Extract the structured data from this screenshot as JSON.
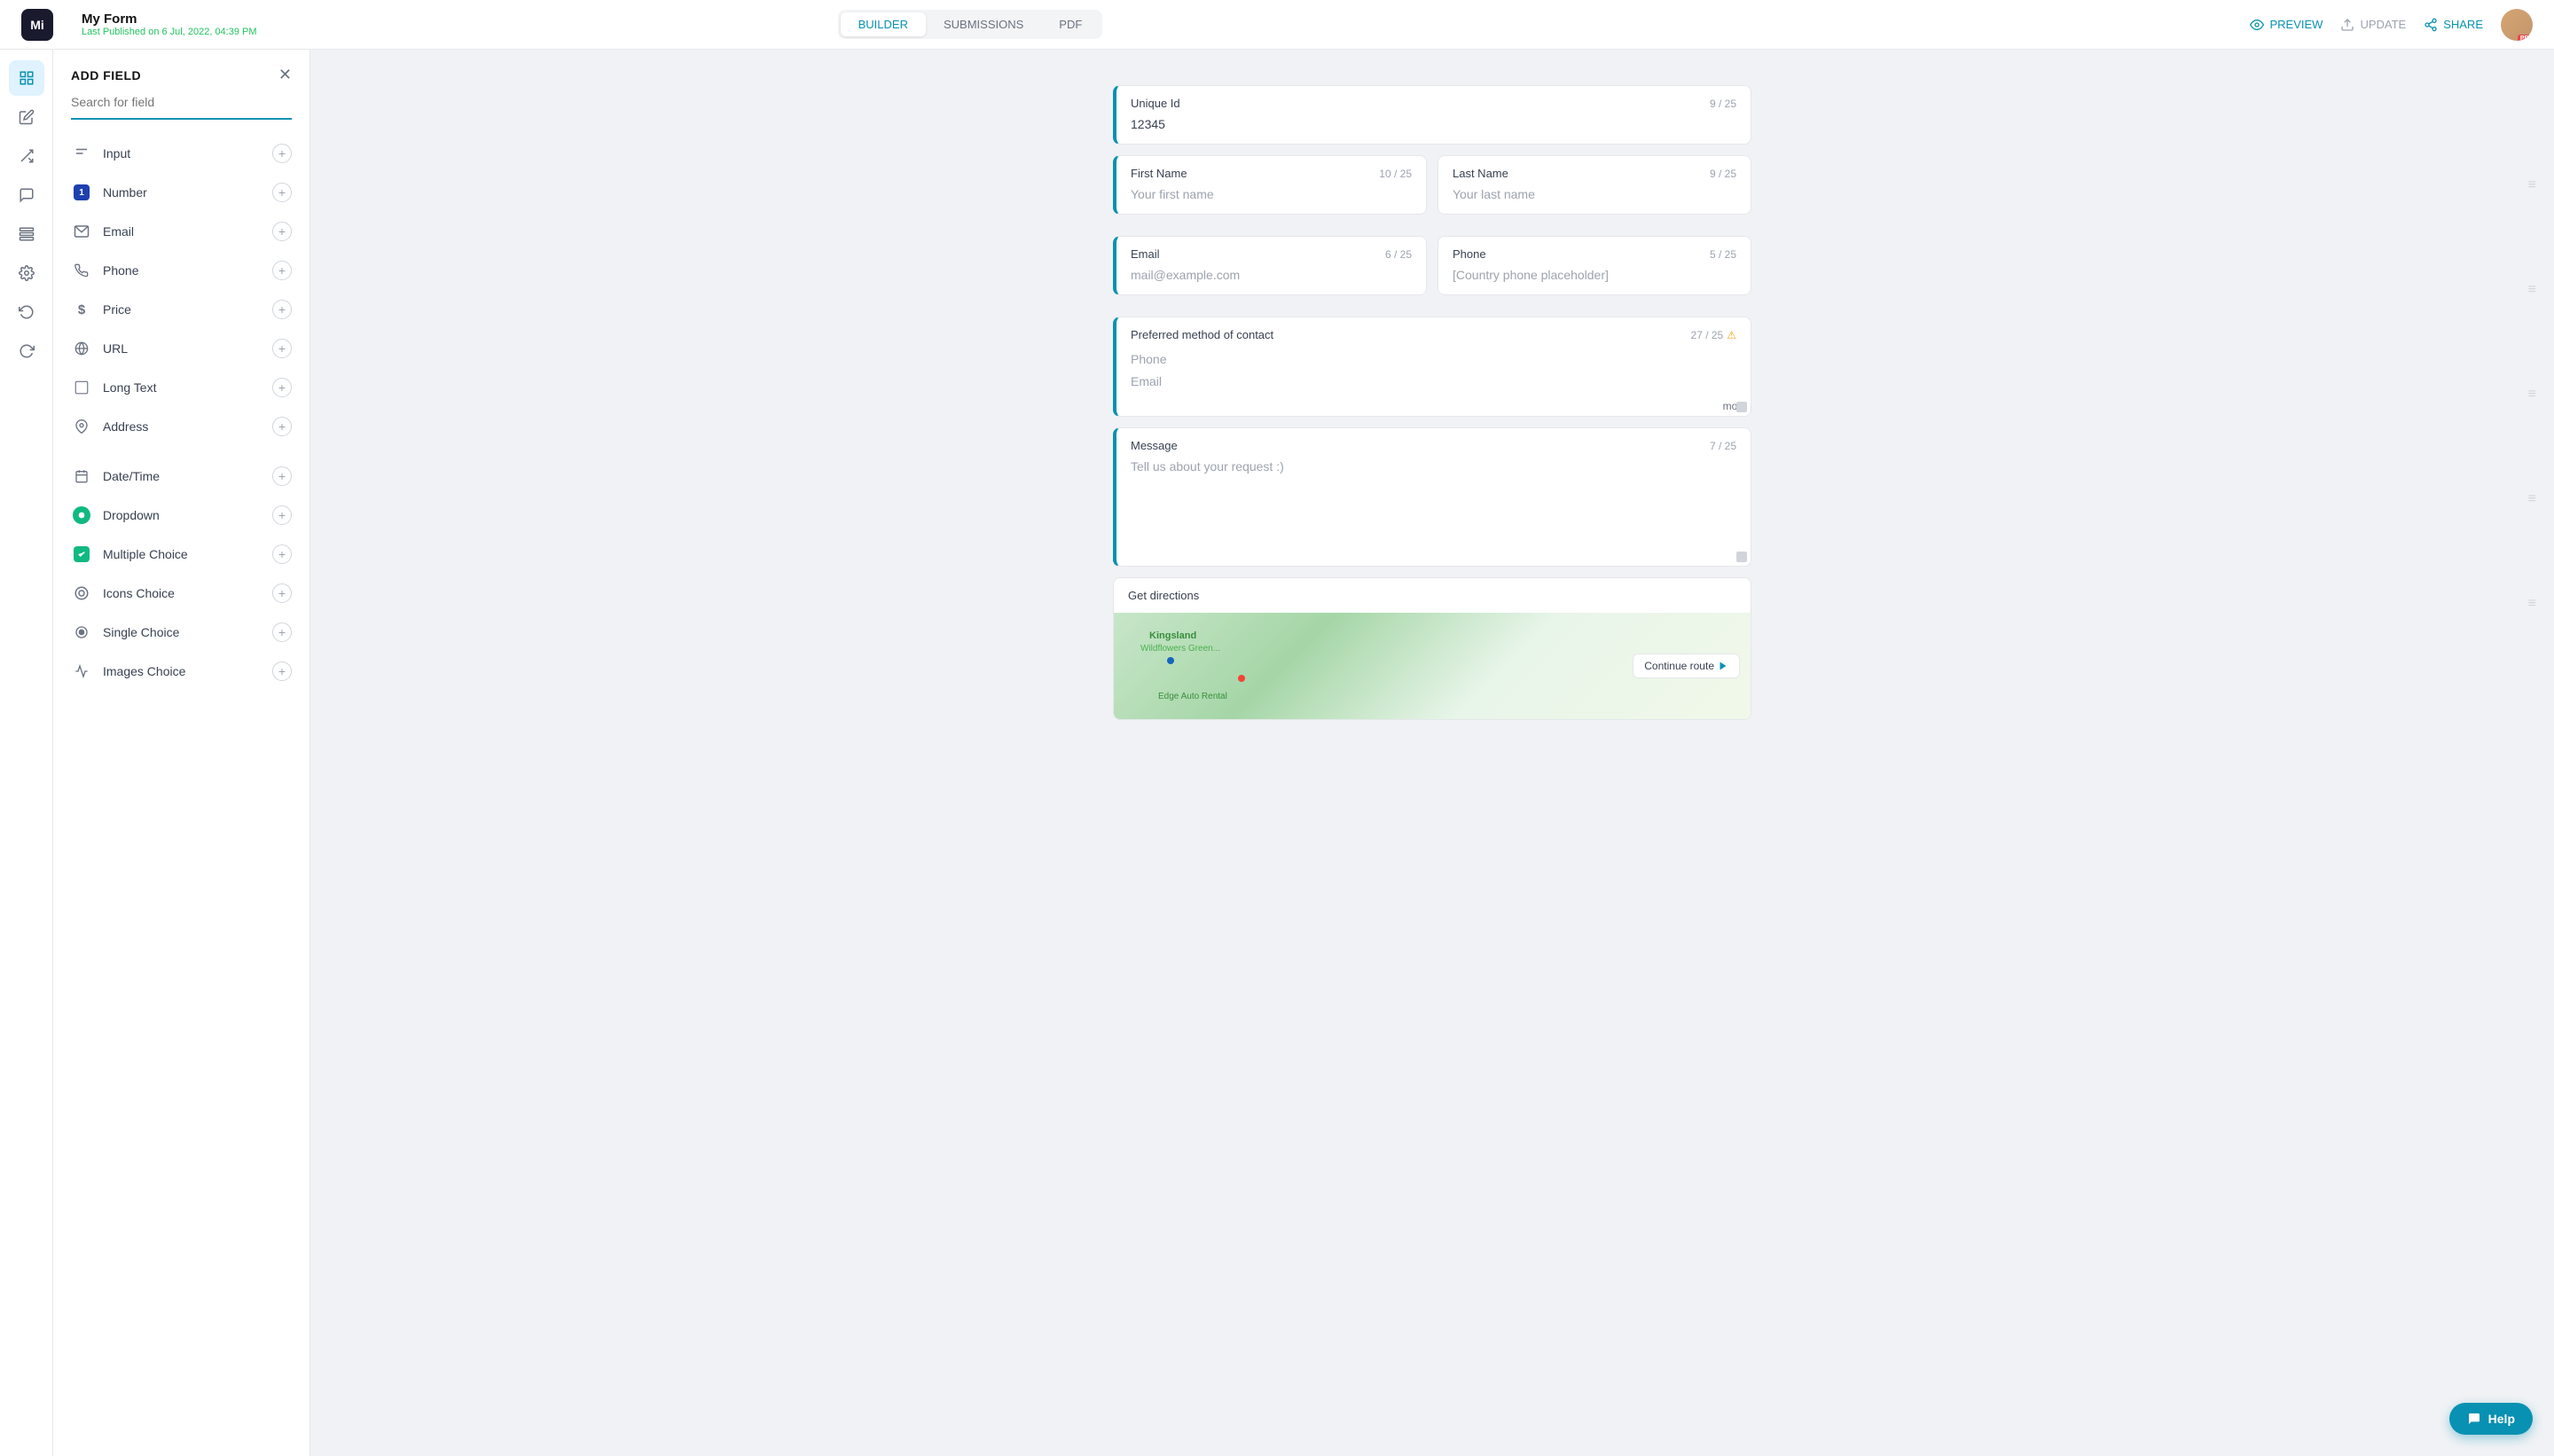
{
  "header": {
    "logo_text": "Mi",
    "form_title": "My Form",
    "form_subtitle": "Last Published on 6 Jul, 2022, 04:39 PM",
    "tabs": [
      {
        "id": "builder",
        "label": "BUILDER",
        "active": true
      },
      {
        "id": "submissions",
        "label": "SUBMISSIONS",
        "active": false
      },
      {
        "id": "pdf",
        "label": "PDF",
        "active": false
      }
    ],
    "actions": {
      "preview": "PREVIEW",
      "update": "UPDATE",
      "share": "SHARE"
    }
  },
  "add_field_panel": {
    "title": "ADD FIELD",
    "search_placeholder": "Search for field",
    "fields": [
      {
        "id": "input",
        "label": "Input",
        "icon": "T"
      },
      {
        "id": "number",
        "label": "Number",
        "icon": "1",
        "badge": true
      },
      {
        "id": "email",
        "label": "Email",
        "icon": "✉"
      },
      {
        "id": "phone",
        "label": "Phone",
        "icon": "📞"
      },
      {
        "id": "price",
        "label": "Price",
        "icon": "$"
      },
      {
        "id": "url",
        "label": "URL",
        "icon": "🌐"
      },
      {
        "id": "long-text",
        "label": "Long Text",
        "icon": "▭"
      },
      {
        "id": "address",
        "label": "Address",
        "icon": "📍"
      },
      {
        "id": "datetime",
        "label": "Date/Time",
        "icon": "📅"
      },
      {
        "id": "dropdown",
        "label": "Dropdown",
        "icon": "●"
      },
      {
        "id": "multiple-choice",
        "label": "Multiple Choice",
        "icon": "✓"
      },
      {
        "id": "icons-choice",
        "label": "Icons Choice",
        "icon": "◎"
      },
      {
        "id": "single-choice",
        "label": "Single Choice",
        "icon": "●"
      },
      {
        "id": "images-choice",
        "label": "Images Choice",
        "icon": "📈"
      }
    ]
  },
  "form_fields": [
    {
      "id": "unique-id",
      "label": "Unique Id",
      "count": "9 / 25",
      "value": "12345",
      "placeholder": "",
      "accent": true,
      "type": "value"
    },
    {
      "id": "first-name",
      "label": "First Name",
      "count": "10 / 25",
      "placeholder": "Your first name",
      "accent": true,
      "type": "placeholder",
      "half": true
    },
    {
      "id": "last-name",
      "label": "Last Name",
      "count": "9 / 25",
      "placeholder": "Your last name",
      "accent": false,
      "type": "placeholder",
      "half": true
    },
    {
      "id": "email",
      "label": "Email",
      "count": "6 / 25",
      "placeholder": "mail@example.com",
      "accent": true,
      "type": "placeholder",
      "half": true
    },
    {
      "id": "phone",
      "label": "Phone",
      "count": "5 / 25",
      "placeholder": "[Country phone placeholder]",
      "accent": false,
      "type": "placeholder",
      "half": true
    },
    {
      "id": "preferred-contact",
      "label": "Preferred method of contact",
      "count": "27 / 25",
      "warn": true,
      "accent": true,
      "type": "list",
      "items": [
        "Phone",
        "Email"
      ],
      "more": "more"
    },
    {
      "id": "message",
      "label": "Message",
      "count": "7 / 25",
      "placeholder": "Tell us about your request :)",
      "accent": true,
      "type": "textarea"
    },
    {
      "id": "get-directions",
      "label": "Get directions",
      "type": "map",
      "map_btn": "Continue route"
    }
  ],
  "help_btn": "Help"
}
